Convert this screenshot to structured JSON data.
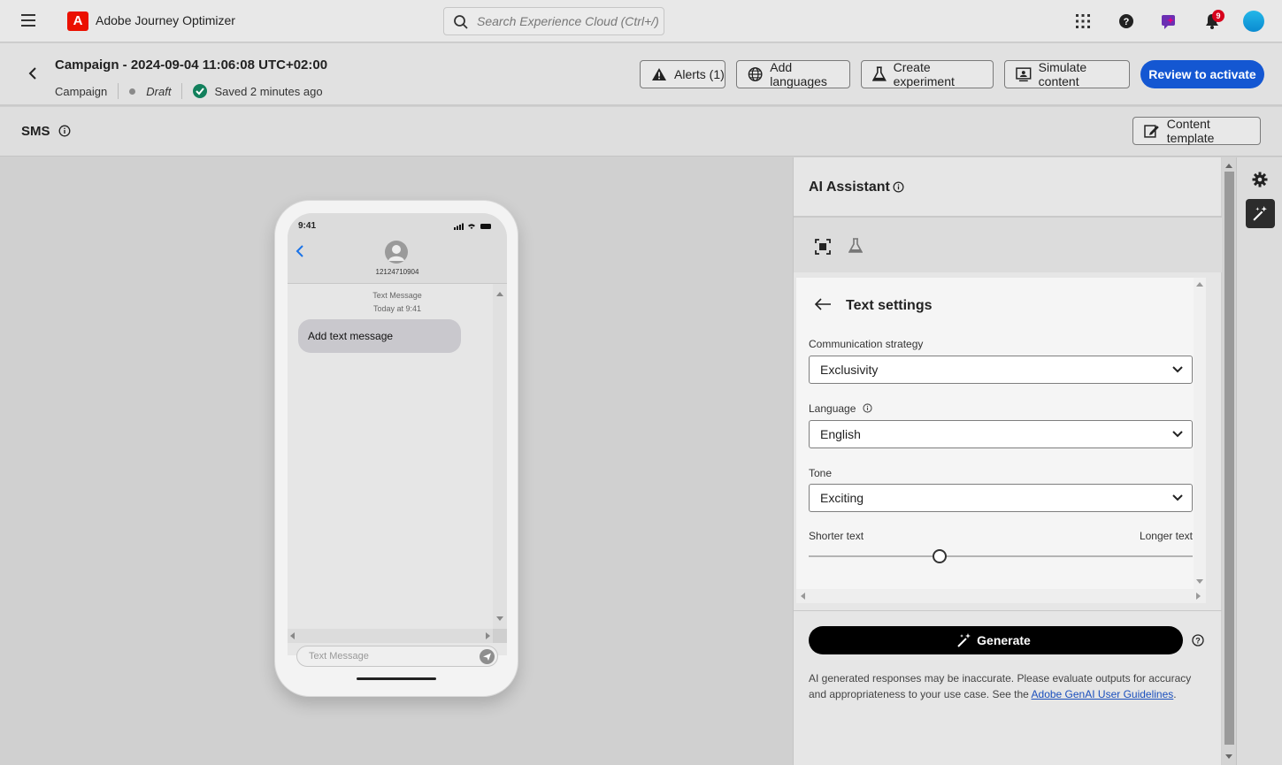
{
  "shell": {
    "app_name": "Adobe Journey Optimizer",
    "search_placeholder": "Search Experience Cloud (Ctrl+/)",
    "notification_count": "9",
    "icons": [
      "menu-icon",
      "adobe-logo-icon",
      "search-icon",
      "apps-grid-icon",
      "help-icon",
      "genai-icon",
      "bell-icon",
      "avatar"
    ]
  },
  "campaign": {
    "title": "Campaign - 2024-09-04 11:06:08 UTC+02:00",
    "type": "Campaign",
    "status": "Draft",
    "saved": "Saved 2 minutes ago",
    "buttons": {
      "alerts": "Alerts (1)",
      "add_languages": "Add languages",
      "create_experiment": "Create experiment",
      "simulate": "Simulate content",
      "review": "Review to activate"
    }
  },
  "sms_bar": {
    "label": "SMS",
    "content_template": "Content template"
  },
  "phone_preview": {
    "time": "9:41",
    "phone_number": "12124710904",
    "meta_line1": "Text Message",
    "meta_line2": "Today at 9:41",
    "bubble": "Add text message",
    "input_placeholder": "Text Message"
  },
  "ai_panel": {
    "title": "AI Assistant",
    "settings_title": "Text settings",
    "fields": {
      "strategy_label": "Communication strategy",
      "strategy_value": "Exclusivity",
      "language_label": "Language",
      "language_value": "English",
      "tone_label": "Tone",
      "tone_value": "Exciting"
    },
    "length_slider": {
      "min_label": "Shorter text",
      "max_label": "Longer text",
      "value_fraction": 0.34
    },
    "generate": "Generate",
    "disclaimer": "AI generated responses may be inaccurate. Please evaluate outputs for accuracy and appropriateness to your use case. See the ",
    "disclaimer_link": "Adobe GenAI User Guidelines",
    "disclaimer_end": "."
  },
  "colors": {
    "primary_button": "#1457d2",
    "adobe_red": "#eb1000",
    "success_green": "#12805c",
    "notification_badge": "#d7001c"
  }
}
